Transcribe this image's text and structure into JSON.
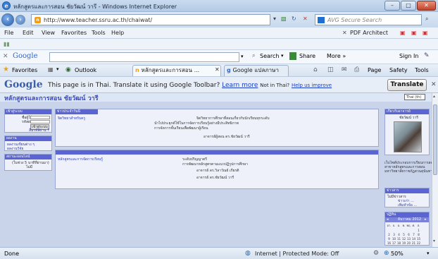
{
  "window": {
    "title": "หลักสูตรและการสอน ชัยวัฒน์ วารี - Windows Internet Explorer",
    "minimize": "–",
    "maximize": "□",
    "close": "✕"
  },
  "address_bar": {
    "url": "http://www.teacher.ssru.ac.th/chaiwat/",
    "search_placeholder": "AVG Secure Search"
  },
  "menu": {
    "items": [
      "File",
      "Edit",
      "View",
      "Favorites",
      "Tools",
      "Help"
    ],
    "pdf_architect": "PDF Architect"
  },
  "google_toolbar": {
    "logo": "Google",
    "search_label": "Search",
    "share_label": "Share",
    "more_label": "More »",
    "signin_label": "Sign In"
  },
  "favorites_bar": {
    "favorites_label": "Favorites",
    "outlook_label": "Outlook",
    "tabs": [
      "หลักสูตรและการสอน ...",
      "Google แปลภาษา"
    ],
    "commands": [
      "Page",
      "Safety",
      "Tools"
    ]
  },
  "translate_bar": {
    "logo": "Google",
    "message": "This page is in Thai.  Translate it using Google Toolbar?",
    "learn_more": "Learn more",
    "not_in_thai": "Not in Thai?",
    "help_us": "Help us improve",
    "button": "Translate"
  },
  "page": {
    "site_title": "หลักสูตรและการสอน ชัยวัฒน์ วารี",
    "language_select_label": "Thai (th)",
    "left_panels": [
      {
        "head": "เข้าสู่ระบบ",
        "lines": [
          "ชื่อผู้ใช้",
          "รหัสผ่าน",
          "เข้าสู่ระบบ",
          "ลืมรหัสผ่าน ?"
        ]
      },
      {
        "head": "ผลงาน",
        "lines": [
          "ผลงานเขียนต่าง ๆ",
          "ผลงานวิจัย"
        ]
      },
      {
        "head": "สถานะออนไลน์",
        "lines": [
          "(ในช่วง 5 นาทีที่ผ่านมา)",
          "ไม่มี"
        ]
      }
    ],
    "main_panels": [
      {
        "head": "ข่าวประจำวันนี้",
        "link": "จิตวิทยาสำหรับครู",
        "body": [
          "จิตวิทยาการศึกษาที่สอนเกี่ยวกับนักเรียนทุกระดับ",
          "นำไปประยุกต์ใช้ในการจัดการเรียนรู้อย่างมีประสิทธิภาพ",
          "การจัดการชั้นเรียนเพื่อพัฒนาผู้เรียน",
          "อาจารย์ผู้สอน ดร.ชัยวัฒน์ วารี"
        ]
      },
      {
        "head": "",
        "link": "หลักสูตรและการจัดการเรียนรู้",
        "body": [
          "ระดับปริญญาตรี",
          "การพัฒนาหลักสูตรตามแนวปฏิรูปการศึกษา",
          "อาจารย์ ดร.วิลาวัณย์ เกียรติ",
          "อาจารย์ ดร.ชัยวัฒน์ วารี"
        ]
      }
    ],
    "right_panels": {
      "profile_head": "เกี่ยวกับอาจารย์",
      "profile_name": "ชัยวัฒน์ วารี",
      "note_lines": [
        "เว็บไซต์ประกอบการเรียนการสอน",
        "สาขาหลักสูตรและการสอน",
        "มหาวิทยาลัยราชภัฏสวนสุนันทา"
      ],
      "news_head": "ข่าวสาร",
      "news_lines": [
        "ไม่มีข่าวสาร",
        "ข่าวเก่า ...",
        "เพิ่มหัวข้อ ..."
      ],
      "calendar_head": "ปฏิทิน",
      "calendar_month": "ธันวาคม 2012",
      "calendar_days": [
        "อา.",
        "จ.",
        "อ.",
        "พ.",
        "พฤ.",
        "ศ.",
        "ส."
      ],
      "calendar_weeks": [
        [
          "",
          "",
          "",
          "",
          "",
          "",
          "1"
        ],
        [
          "2",
          "3",
          "4",
          "5",
          "6",
          "7",
          "8"
        ],
        [
          "9",
          "10",
          "11",
          "12",
          "13",
          "14",
          "15"
        ],
        [
          "16",
          "17",
          "18",
          "19",
          "20",
          "21",
          "22"
        ]
      ]
    }
  },
  "status_bar": {
    "left": "Done",
    "zone": "Internet | Protected Mode: Off",
    "zoom": "50%"
  },
  "colors": {
    "page_bg": "#c9d4ea",
    "panel_header": "#5a64d2",
    "site_title": "#3b4bc2",
    "link": "#1a3fc4"
  }
}
